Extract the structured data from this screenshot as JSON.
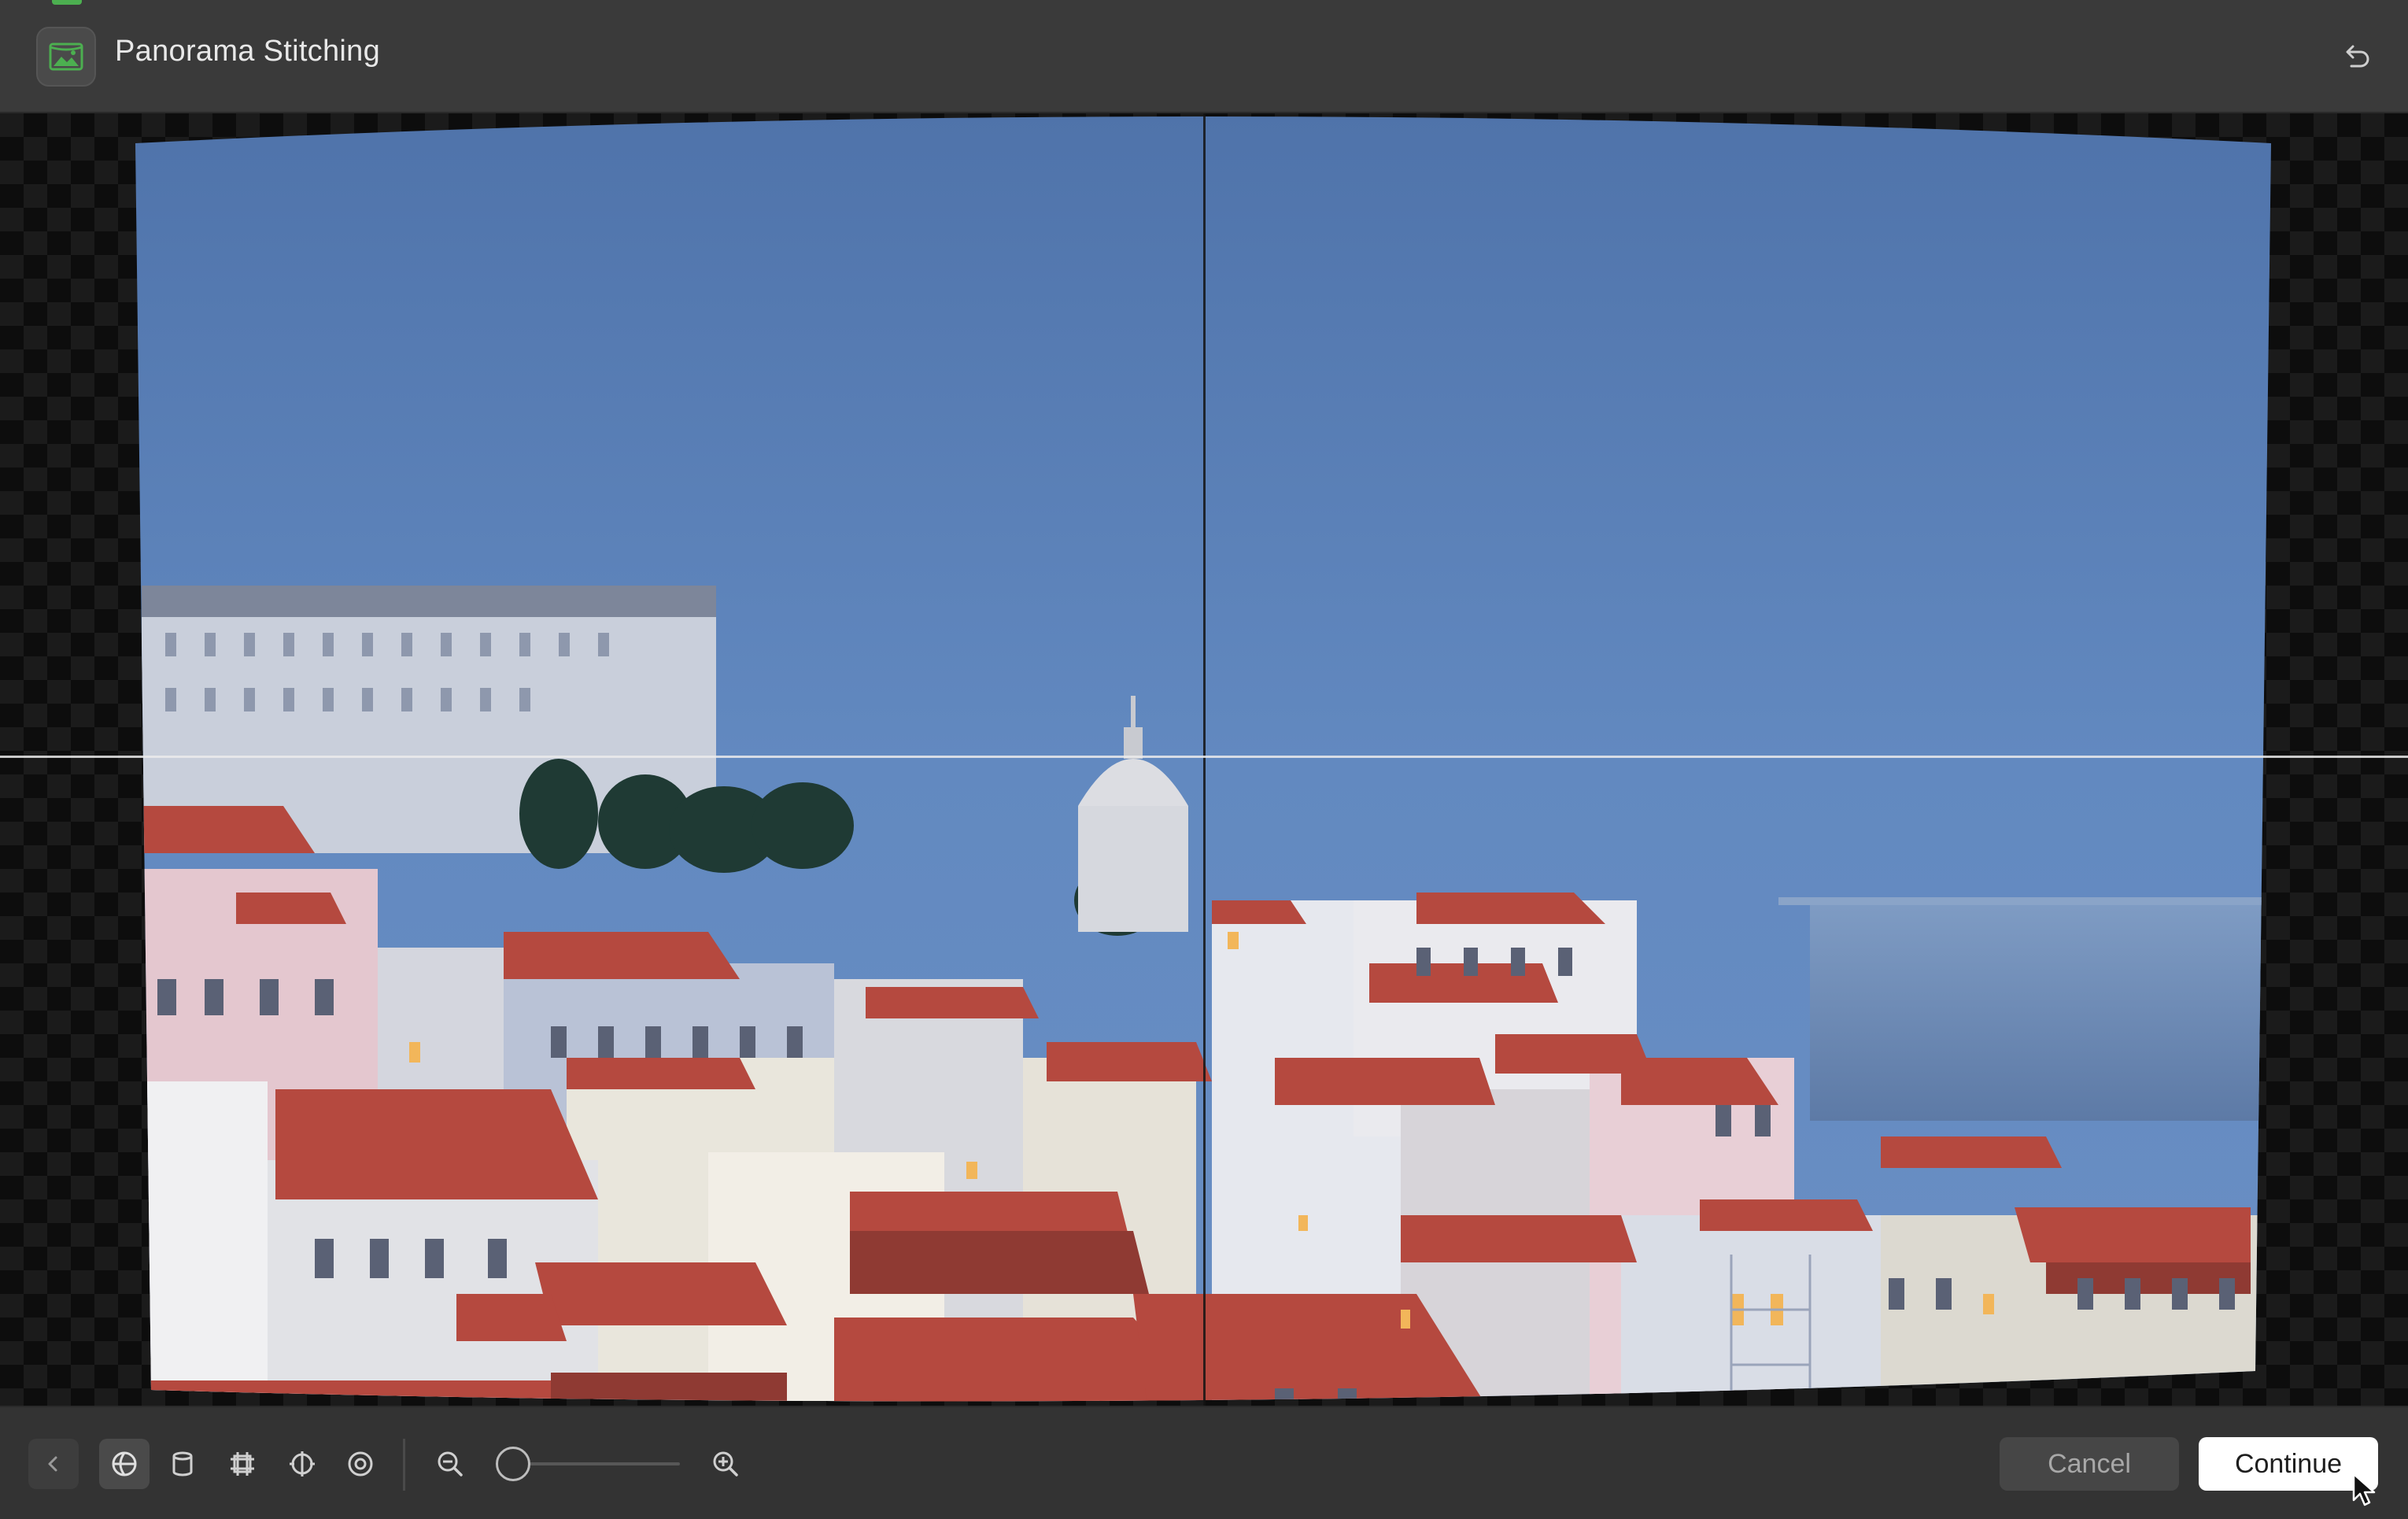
{
  "window": {
    "title": "Panorama Stitching",
    "app_icon": "panorama-photo-icon",
    "undo_icon": "undo-arrow-icon"
  },
  "canvas": {
    "background": "transparency-checkerboard",
    "image_description": "stitched panorama of Lisbon rooftops at dusk",
    "guides": [
      "vertical-center",
      "horizontal-center"
    ]
  },
  "toolbar": {
    "back_icon": "chevron-left-icon",
    "projection_tools": [
      {
        "name": "spherical-projection-icon",
        "active": true
      },
      {
        "name": "cylindrical-projection-icon",
        "active": false
      },
      {
        "name": "perspective-grid-icon",
        "active": false
      },
      {
        "name": "fisheye-projection-icon",
        "active": false
      },
      {
        "name": "little-planet-icon",
        "active": false
      }
    ],
    "zoom_out_icon": "zoom-out-icon",
    "zoom_in_icon": "zoom-in-icon",
    "zoom_level": 0,
    "cancel_label": "Cancel",
    "continue_label": "Continue"
  },
  "colors": {
    "accent": "#4caf50",
    "primary_button": "#ffffff",
    "secondary_button": "#464646"
  }
}
